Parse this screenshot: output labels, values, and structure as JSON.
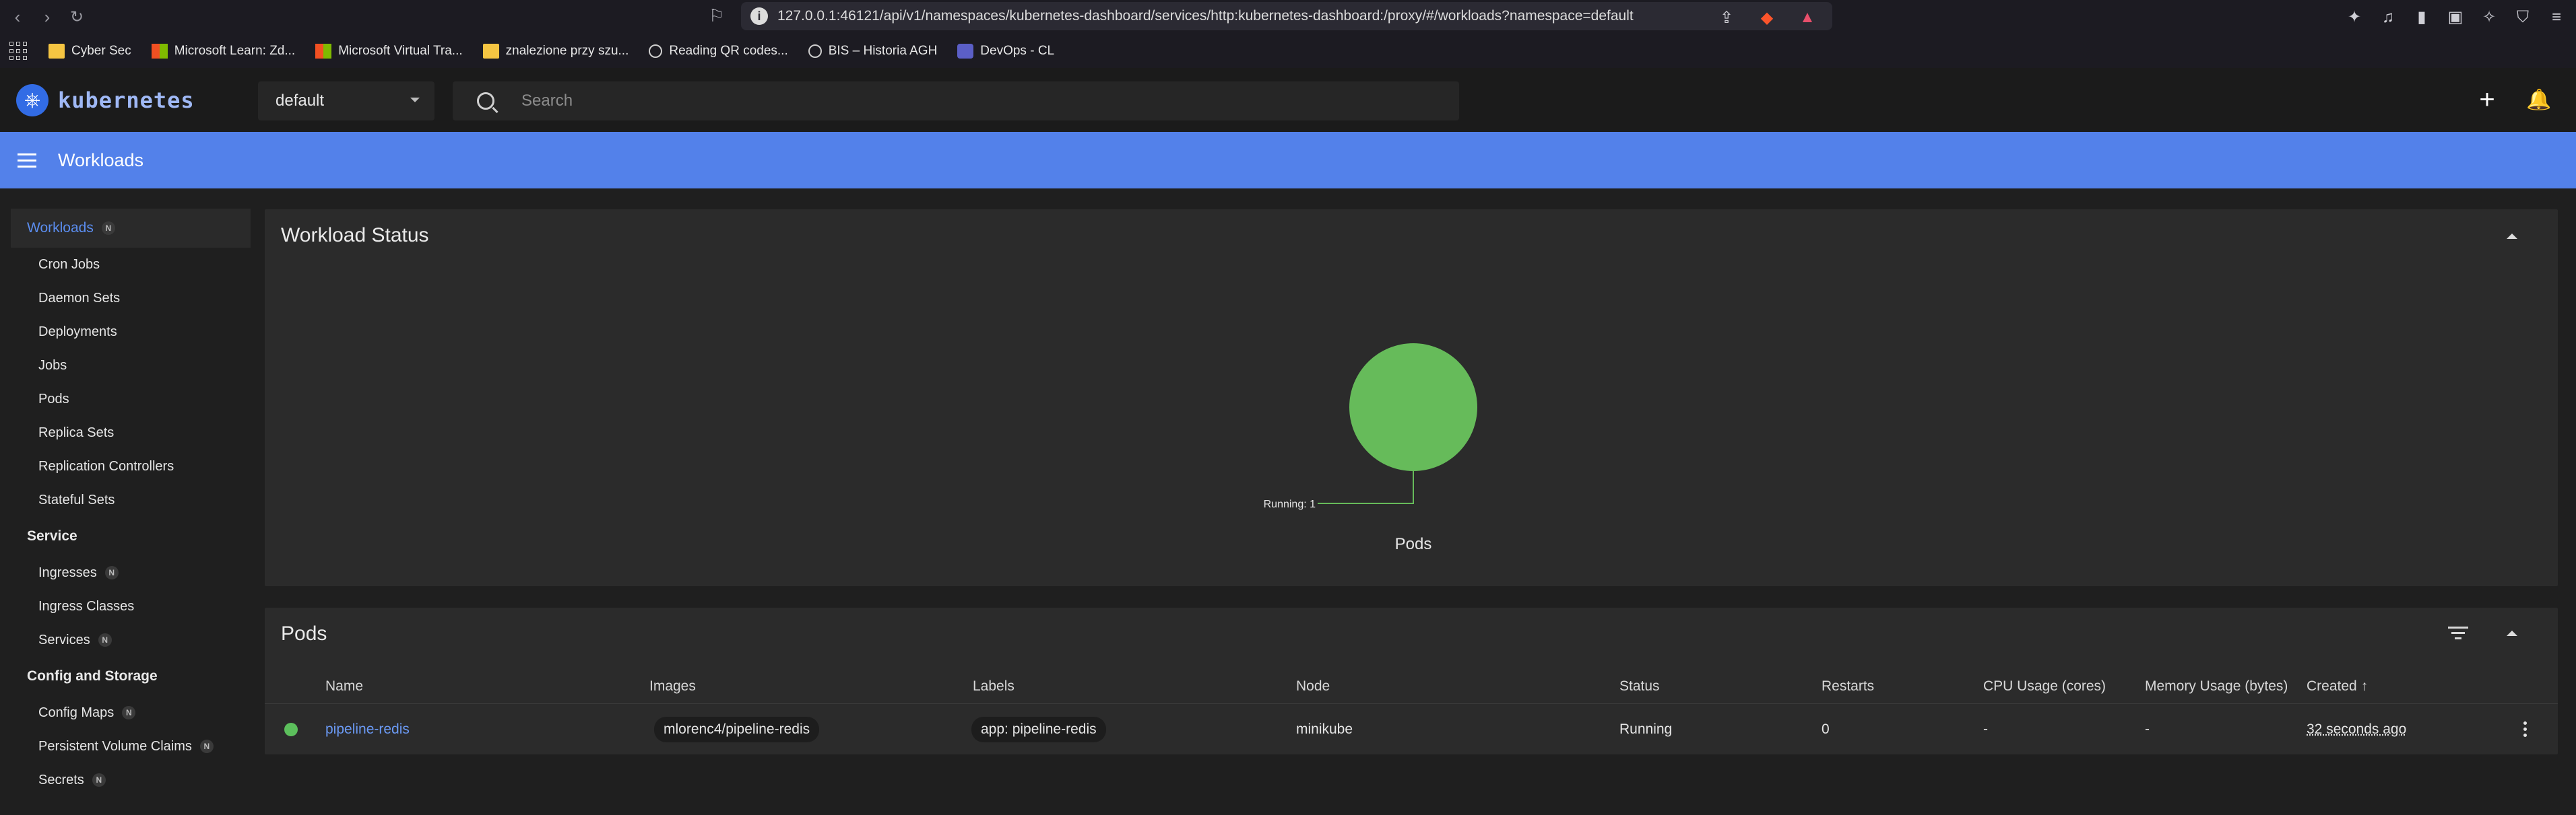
{
  "browser": {
    "url": "127.0.0.1:46121/api/v1/namespaces/kubernetes-dashboard/services/http:kubernetes-dashboard:/proxy/#/workloads?namespace=default",
    "bookmarks": [
      {
        "label": "Cyber Sec",
        "icon": "folder"
      },
      {
        "label": "Microsoft Learn: Zd...",
        "icon": "microsoft"
      },
      {
        "label": "Microsoft Virtual Tra...",
        "icon": "microsoft"
      },
      {
        "label": "znalezione przy szu...",
        "icon": "folder"
      },
      {
        "label": "Reading QR codes...",
        "icon": "globe"
      },
      {
        "label": "BIS – Historia AGH",
        "icon": "globe"
      },
      {
        "label": "DevOps - CL",
        "icon": "teams"
      }
    ]
  },
  "header": {
    "logo_text": "kubernetes",
    "namespace": "default",
    "search_placeholder": "Search"
  },
  "toolbar": {
    "title": "Workloads"
  },
  "sidebar": {
    "sections": [
      {
        "label": "Workloads",
        "badge": "N",
        "active": true,
        "items": [
          {
            "label": "Cron Jobs"
          },
          {
            "label": "Daemon Sets"
          },
          {
            "label": "Deployments"
          },
          {
            "label": "Jobs"
          },
          {
            "label": "Pods"
          },
          {
            "label": "Replica Sets"
          },
          {
            "label": "Replication Controllers"
          },
          {
            "label": "Stateful Sets"
          }
        ]
      },
      {
        "label": "Service",
        "items": [
          {
            "label": "Ingresses",
            "badge": "N"
          },
          {
            "label": "Ingress Classes"
          },
          {
            "label": "Services",
            "badge": "N"
          }
        ]
      },
      {
        "label": "Config and Storage",
        "items": [
          {
            "label": "Config Maps",
            "badge": "N"
          },
          {
            "label": "Persistent Volume Claims",
            "badge": "N"
          },
          {
            "label": "Secrets",
            "badge": "N"
          }
        ]
      }
    ]
  },
  "workload_status": {
    "title": "Workload Status",
    "chart_label": "Pods",
    "running_label": "Running: 1",
    "running_count": 1,
    "running_color": "#66bb5a"
  },
  "pods": {
    "title": "Pods",
    "columns": [
      "Name",
      "Images",
      "Labels",
      "Node",
      "Status",
      "Restarts",
      "CPU Usage (cores)",
      "Memory Usage (bytes)",
      "Created"
    ],
    "sort_indicator": "↑",
    "rows": [
      {
        "name": "pipeline-redis",
        "image": "mlorenc4/pipeline-redis",
        "label": "app: pipeline-redis",
        "node": "minikube",
        "status": "Running",
        "restarts": "0",
        "cpu": "-",
        "memory": "-",
        "created": "32 seconds ago"
      }
    ]
  }
}
